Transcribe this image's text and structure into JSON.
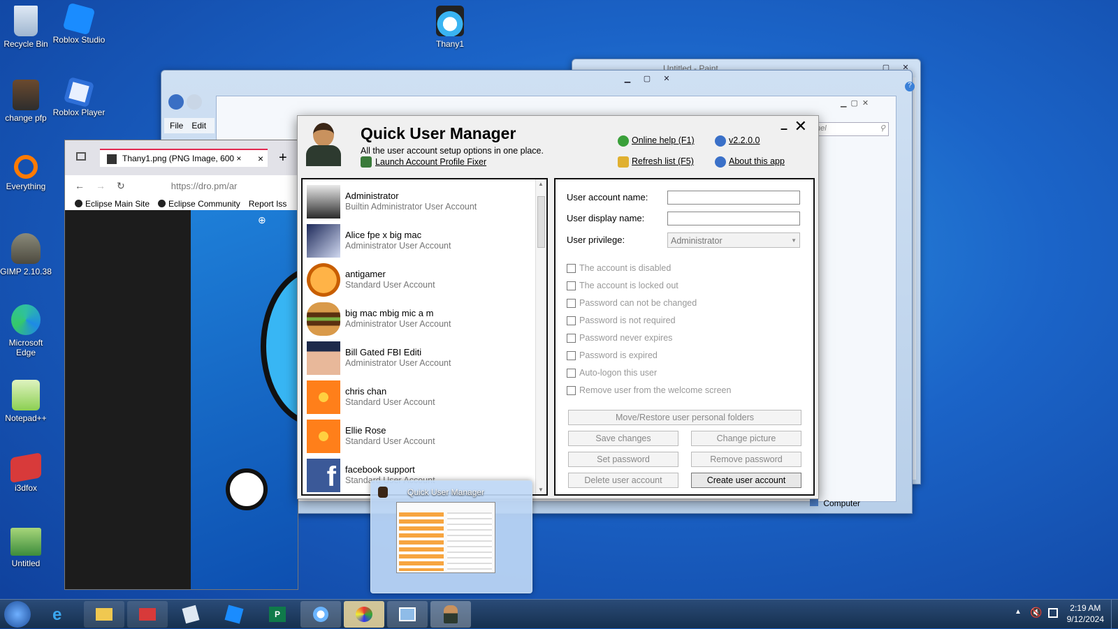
{
  "desktop_icons": [
    {
      "label": "Recycle Bin"
    },
    {
      "label": "Roblox Studio"
    },
    {
      "label": "change pfp"
    },
    {
      "label": "Roblox Player"
    },
    {
      "label": "Everything"
    },
    {
      "label": "GIMP 2.10.38"
    },
    {
      "label": "Microsoft Edge"
    },
    {
      "label": "Notepad++"
    },
    {
      "label": "i3dfox"
    },
    {
      "label": "Untitled"
    },
    {
      "label": "Thany1"
    }
  ],
  "paint_window": {
    "title": "Untitled - Paint"
  },
  "explorer_window": {
    "menu_file": "File",
    "menu_edit": "Edit",
    "search_placeholder": "l Panel",
    "status_item": "Computer"
  },
  "firefox": {
    "tab_title": "Thany1.png (PNG Image, 600 ×",
    "tab_close": "×",
    "new_tab": "+",
    "url": "https://dro.pm/ar",
    "bookmarks": [
      "Eclipse Main Site",
      "Eclipse Community",
      "Report Iss"
    ]
  },
  "qum": {
    "title": "Quick User Manager",
    "subtitle": "All the user account setup options in one place.",
    "launch_fixer": "Launch Account Profile Fixer",
    "online_help": "Online help (F1)",
    "refresh": "Refresh list (F5)",
    "version": "v2.2.0.0",
    "about": "About this app",
    "min": "–",
    "close": "✕",
    "users": [
      {
        "name": "Administrator",
        "type": "Builtin Administrator User Account"
      },
      {
        "name": "Alice fpe x big mac",
        "type": "Administrator User Account"
      },
      {
        "name": "antigamer",
        "type": "Standard User Account"
      },
      {
        "name": "big mac mbig mic a m",
        "type": "Administrator User Account"
      },
      {
        "name": "Bill Gated FBI Editi",
        "type": "Administrator User Account"
      },
      {
        "name": "chris chan",
        "type": "Standard User Account"
      },
      {
        "name": "Ellie Rose",
        "type": "Standard User Account"
      },
      {
        "name": "facebook support",
        "type": "Standard User Account"
      }
    ],
    "labels": {
      "account_name": "User account name:",
      "display_name": "User display name:",
      "privilege": "User privilege:"
    },
    "account_name_value": "",
    "display_name_value": "",
    "privilege_value": "Administrator",
    "checkboxes": [
      "The account is disabled",
      "The account is locked out",
      "Password can not be changed",
      "Password is not required",
      "Password never expires",
      "Password is expired",
      "Auto-logon this user",
      "Remove user from the welcome screen"
    ],
    "buttons": {
      "move_restore": "Move/Restore user personal folders",
      "save": "Save changes",
      "change_picture": "Change picture",
      "set_password": "Set password",
      "remove_password": "Remove password",
      "delete": "Delete user account",
      "create": "Create user account"
    }
  },
  "thumbnail": {
    "title": "Quick User Manager"
  },
  "clock": {
    "time": "2:19 AM",
    "date": "9/12/2024"
  }
}
